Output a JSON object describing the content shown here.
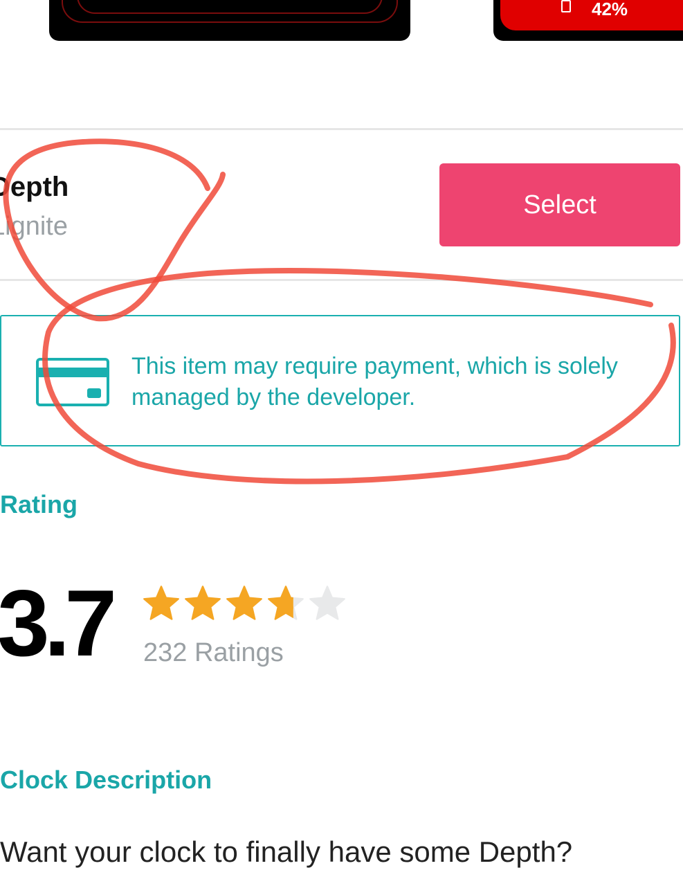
{
  "thumbnails": [
    {
      "name": "clock-thumbnail-1"
    },
    {
      "name": "clock-thumbnail-2",
      "battery_text": "42%"
    }
  ],
  "item": {
    "title": "Depth",
    "developer": "Lignite",
    "select_label": "Select"
  },
  "notice": {
    "icon": "credit-card-icon",
    "text": "This item may require payment, which is solely managed by the developer."
  },
  "rating": {
    "heading": "Rating",
    "score": "3.7",
    "value": 3.7,
    "max": 5,
    "count_label": "232 Ratings",
    "star_color": "#f5a623",
    "empty_star_color": "#e8e9ea"
  },
  "description": {
    "heading": "Clock Description",
    "text": "Want your clock to finally have some Depth?"
  },
  "colors": {
    "accent": "#1aa6a8",
    "select_button": "#ee4470",
    "annotation": "#f04a3a"
  }
}
